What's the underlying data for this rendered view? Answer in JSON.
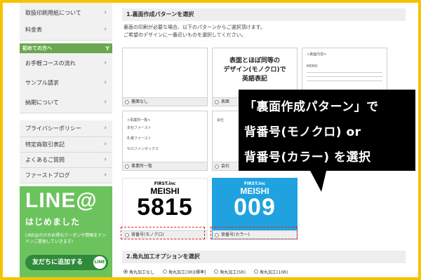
{
  "sidebar": {
    "items_top": [
      {
        "label": "取扱印刷用紙について"
      },
      {
        "label": "料金表"
      }
    ],
    "section_header": "初めての方へ",
    "items_mid": [
      {
        "label": "お手軽コースの流れ"
      },
      {
        "label": "サンプル請求"
      },
      {
        "label": "納期について"
      }
    ],
    "items_bottom": [
      {
        "label": "プライバシーポリシー"
      },
      {
        "label": "特定商取引表記"
      },
      {
        "label": "よくあるご質問"
      },
      {
        "label": "ファーストブログ"
      }
    ],
    "line_banner": {
      "logo": "LINE@",
      "subtitle": "はじめました",
      "description": "LINE@だけのお得なクーポンや情報をドンドンご提供していきます!",
      "button_label": "友だちに追加する",
      "button_icon_text": "LINE"
    }
  },
  "main": {
    "section1_title": "1.裏面作成パターンを選択",
    "section1_desc_line1": "裏面の印刷が必要な場合、以下のパターンからご選択頂けます。",
    "section1_desc_line2": "ご希望のデザインに一番近いものを選択してください。",
    "cards": {
      "none_label": "裏面なし",
      "same_label": "表面",
      "same_text_line1": "表面とほぼ同等の",
      "same_text_line2": "デザイン(モノクロ)で",
      "same_text_line3": "英語表記",
      "third_mini_title": "<裏面内容>",
      "third_mini_memo": "MEMO",
      "list_label": "事業所一覧",
      "list_mini_title": "<事業所一覧>",
      "list_mini_line1": "本社ファースト",
      "list_mini_line2": "札幌ファースト",
      "list_mini_line3": "セロファンボックス",
      "company_label": "会社",
      "company_mini_title": "会社"
    },
    "number_cards": [
      {
        "brand": "FIRST.inc",
        "name": "MEISHI",
        "number": "5815",
        "label": "背番号(モノクロ)"
      },
      {
        "brand": "FIRST.inc",
        "name": "MEISHI",
        "number": "009",
        "label": "背番号(カラー)"
      }
    ],
    "section2_title": "2.角丸加工オプションを選択",
    "corner_options": [
      {
        "label": "角丸加工なし",
        "selected": true
      },
      {
        "label": "角丸加工(3R)[標準]",
        "selected": false
      },
      {
        "label": "角丸加工(5R)",
        "selected": false
      },
      {
        "label": "角丸加工(10R)",
        "selected": false
      }
    ]
  },
  "callout": {
    "line1": "「裏面作成パターン」で",
    "line2": "背番号(モノクロ) or",
    "line3": "背番号(カラー) を選択"
  },
  "colors": {
    "accent_yellow": "#f5c400",
    "line_green": "#6cc35e",
    "color_card_blue": "#1fa2df",
    "highlight_red": "#e02020"
  }
}
